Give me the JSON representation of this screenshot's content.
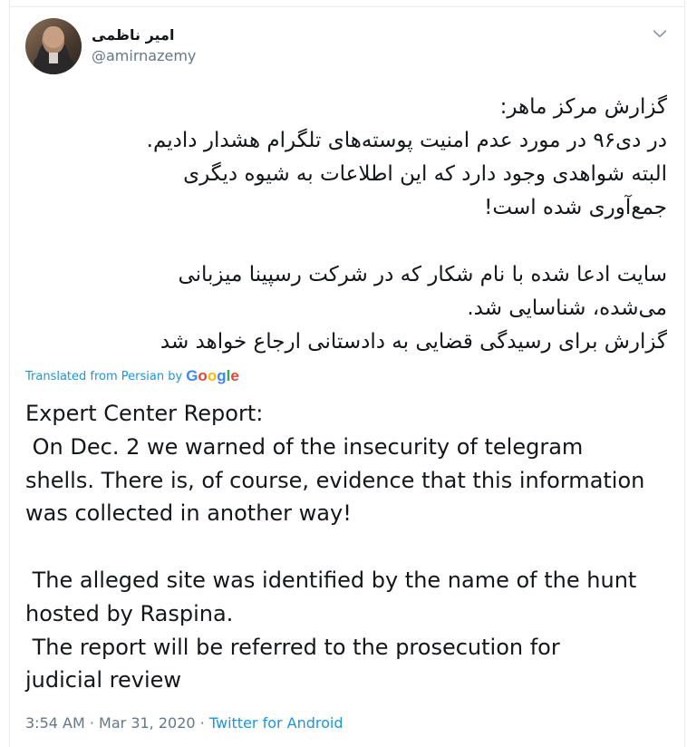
{
  "tweet": {
    "author_name": "امیر ناظمی",
    "author_handle": "@amirnazemy",
    "original_text": "گزارش مرکز ماهر:\nدر دی۹۶ در مورد عدم امنیت پوسته‌های تلگرام هشدار دادیم.\nالبته شواهدی وجود دارد که این اطلاعات به شیوه دیگری\nجمع‌آوری شده است!\n\nسایت ادعا شده با نام شکار که در شرکت رسپینا میزبانی\nمی‌شده، شناسایی شد.\nگزارش برای رسیدگی قضایی به دادستانی ارجاع خواهد شد",
    "translated_label": "Translated from Persian by",
    "google_letters": [
      "G",
      "o",
      "o",
      "g",
      "l",
      "e"
    ],
    "translation_text": "Expert Center Report:\n On Dec. 2 we warned of the insecurity of telegram\nshells. There is, of course, evidence that this information\nwas collected in another way!\n\n The alleged site was identified by the name of the hunt\nhosted by Raspina.\n The report will be referred to the prosecution for\njudicial review",
    "time": "3:54 AM",
    "separator": "·",
    "date": "Mar 31, 2020",
    "source": "Twitter for Android"
  },
  "icons": {
    "menu": "chevron-down-icon"
  },
  "colors": {
    "link": "#1b95e0",
    "secondary_text": "#657786",
    "primary_text": "#14171a",
    "border": "#e6ecf0"
  }
}
